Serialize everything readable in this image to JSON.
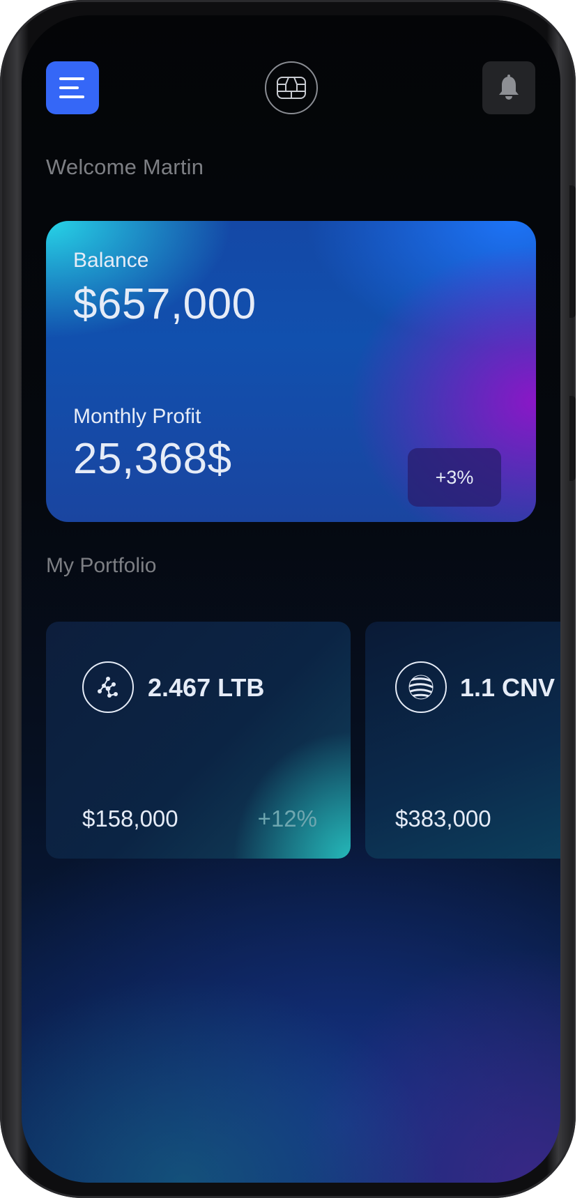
{
  "header": {
    "menu_icon": "hamburger-menu-icon",
    "logo_icon": "sim-chip-icon",
    "notifications_icon": "bell-icon"
  },
  "welcome": "Welcome Martin",
  "balance_card": {
    "balance_label": "Balance",
    "balance_value": "$657,000",
    "profit_label": "Monthly Profit",
    "profit_value": "25,368$",
    "profit_change": "+3%"
  },
  "portfolio": {
    "title": "My Portfolio",
    "items": [
      {
        "icon": "network-nodes-icon",
        "amount": "2.467 LTB",
        "value": "$158,000",
        "change": "+12%"
      },
      {
        "icon": "globe-sphere-icon",
        "amount": "1.1 CNV",
        "value": "$383,000"
      }
    ]
  },
  "colors": {
    "accent": "#3567f7",
    "text_primary": "#e6ecf7",
    "text_muted": "#7d7f84"
  }
}
